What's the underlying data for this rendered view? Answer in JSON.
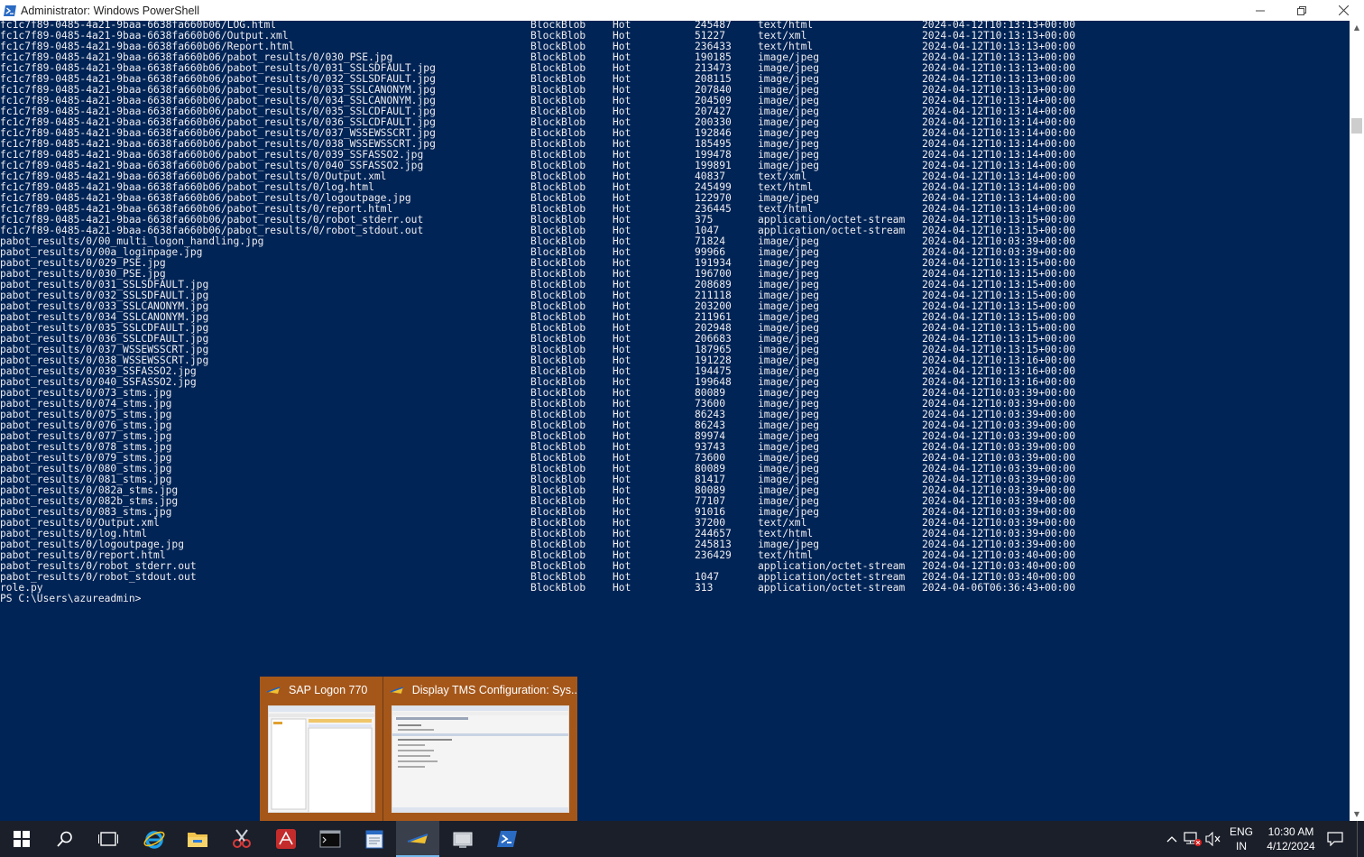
{
  "window": {
    "title": "Administrator: Windows PowerShell"
  },
  "console": {
    "rows": [
      {
        "name": "fc1c7f89-0485-4a21-9baa-6638fa660b06/LOG.html",
        "type": "BlockBlob",
        "tier": "Hot",
        "size": "245487",
        "content_type": "text/html",
        "date": "2024-04-12T10:13:13+00:00"
      },
      {
        "name": "fc1c7f89-0485-4a21-9baa-6638fa660b06/Output.xml",
        "type": "BlockBlob",
        "tier": "Hot",
        "size": "51227",
        "content_type": "text/xml",
        "date": "2024-04-12T10:13:13+00:00"
      },
      {
        "name": "fc1c7f89-0485-4a21-9baa-6638fa660b06/Report.html",
        "type": "BlockBlob",
        "tier": "Hot",
        "size": "236433",
        "content_type": "text/html",
        "date": "2024-04-12T10:13:13+00:00"
      },
      {
        "name": "fc1c7f89-0485-4a21-9baa-6638fa660b06/pabot_results/0/030_PSE.jpg",
        "type": "BlockBlob",
        "tier": "Hot",
        "size": "190185",
        "content_type": "image/jpeg",
        "date": "2024-04-12T10:13:13+00:00"
      },
      {
        "name": "fc1c7f89-0485-4a21-9baa-6638fa660b06/pabot_results/0/031_SSLSDFAULT.jpg",
        "type": "BlockBlob",
        "tier": "Hot",
        "size": "213473",
        "content_type": "image/jpeg",
        "date": "2024-04-12T10:13:13+00:00"
      },
      {
        "name": "fc1c7f89-0485-4a21-9baa-6638fa660b06/pabot_results/0/032_SSLSDFAULT.jpg",
        "type": "BlockBlob",
        "tier": "Hot",
        "size": "208115",
        "content_type": "image/jpeg",
        "date": "2024-04-12T10:13:13+00:00"
      },
      {
        "name": "fc1c7f89-0485-4a21-9baa-6638fa660b06/pabot_results/0/033_SSLCANONYM.jpg",
        "type": "BlockBlob",
        "tier": "Hot",
        "size": "207840",
        "content_type": "image/jpeg",
        "date": "2024-04-12T10:13:13+00:00"
      },
      {
        "name": "fc1c7f89-0485-4a21-9baa-6638fa660b06/pabot_results/0/034_SSLCANONYM.jpg",
        "type": "BlockBlob",
        "tier": "Hot",
        "size": "204509",
        "content_type": "image/jpeg",
        "date": "2024-04-12T10:13:14+00:00"
      },
      {
        "name": "fc1c7f89-0485-4a21-9baa-6638fa660b06/pabot_results/0/035_SSLCDFAULT.jpg",
        "type": "BlockBlob",
        "tier": "Hot",
        "size": "207427",
        "content_type": "image/jpeg",
        "date": "2024-04-12T10:13:14+00:00"
      },
      {
        "name": "fc1c7f89-0485-4a21-9baa-6638fa660b06/pabot_results/0/036_SSLCDFAULT.jpg",
        "type": "BlockBlob",
        "tier": "Hot",
        "size": "200330",
        "content_type": "image/jpeg",
        "date": "2024-04-12T10:13:14+00:00"
      },
      {
        "name": "fc1c7f89-0485-4a21-9baa-6638fa660b06/pabot_results/0/037_WSSEWSSCRT.jpg",
        "type": "BlockBlob",
        "tier": "Hot",
        "size": "192846",
        "content_type": "image/jpeg",
        "date": "2024-04-12T10:13:14+00:00"
      },
      {
        "name": "fc1c7f89-0485-4a21-9baa-6638fa660b06/pabot_results/0/038_WSSEWSSCRT.jpg",
        "type": "BlockBlob",
        "tier": "Hot",
        "size": "185495",
        "content_type": "image/jpeg",
        "date": "2024-04-12T10:13:14+00:00"
      },
      {
        "name": "fc1c7f89-0485-4a21-9baa-6638fa660b06/pabot_results/0/039_SSFASSO2.jpg",
        "type": "BlockBlob",
        "tier": "Hot",
        "size": "199478",
        "content_type": "image/jpeg",
        "date": "2024-04-12T10:13:14+00:00"
      },
      {
        "name": "fc1c7f89-0485-4a21-9baa-6638fa660b06/pabot_results/0/040_SSFASSO2.jpg",
        "type": "BlockBlob",
        "tier": "Hot",
        "size": "199891",
        "content_type": "image/jpeg",
        "date": "2024-04-12T10:13:14+00:00"
      },
      {
        "name": "fc1c7f89-0485-4a21-9baa-6638fa660b06/pabot_results/0/Output.xml",
        "type": "BlockBlob",
        "tier": "Hot",
        "size": "40837",
        "content_type": "text/xml",
        "date": "2024-04-12T10:13:14+00:00"
      },
      {
        "name": "fc1c7f89-0485-4a21-9baa-6638fa660b06/pabot_results/0/log.html",
        "type": "BlockBlob",
        "tier": "Hot",
        "size": "245499",
        "content_type": "text/html",
        "date": "2024-04-12T10:13:14+00:00"
      },
      {
        "name": "fc1c7f89-0485-4a21-9baa-6638fa660b06/pabot_results/0/logoutpage.jpg",
        "type": "BlockBlob",
        "tier": "Hot",
        "size": "122970",
        "content_type": "image/jpeg",
        "date": "2024-04-12T10:13:14+00:00"
      },
      {
        "name": "fc1c7f89-0485-4a21-9baa-6638fa660b06/pabot_results/0/report.html",
        "type": "BlockBlob",
        "tier": "Hot",
        "size": "236445",
        "content_type": "text/html",
        "date": "2024-04-12T10:13:14+00:00"
      },
      {
        "name": "fc1c7f89-0485-4a21-9baa-6638fa660b06/pabot_results/0/robot_stderr.out",
        "type": "BlockBlob",
        "tier": "Hot",
        "size": "375",
        "content_type": "application/octet-stream",
        "date": "2024-04-12T10:13:15+00:00"
      },
      {
        "name": "fc1c7f89-0485-4a21-9baa-6638fa660b06/pabot_results/0/robot_stdout.out",
        "type": "BlockBlob",
        "tier": "Hot",
        "size": "1047",
        "content_type": "application/octet-stream",
        "date": "2024-04-12T10:13:15+00:00"
      },
      {
        "name": "pabot_results/0/00_multi_logon_handling.jpg",
        "type": "BlockBlob",
        "tier": "Hot",
        "size": "71824",
        "content_type": "image/jpeg",
        "date": "2024-04-12T10:03:39+00:00"
      },
      {
        "name": "pabot_results/0/00a_loginpage.jpg",
        "type": "BlockBlob",
        "tier": "Hot",
        "size": "99966",
        "content_type": "image/jpeg",
        "date": "2024-04-12T10:03:39+00:00"
      },
      {
        "name": "pabot_results/0/029_PSE.jpg",
        "type": "BlockBlob",
        "tier": "Hot",
        "size": "191934",
        "content_type": "image/jpeg",
        "date": "2024-04-12T10:13:15+00:00"
      },
      {
        "name": "pabot_results/0/030_PSE.jpg",
        "type": "BlockBlob",
        "tier": "Hot",
        "size": "196700",
        "content_type": "image/jpeg",
        "date": "2024-04-12T10:13:15+00:00"
      },
      {
        "name": "pabot_results/0/031_SSLSDFAULT.jpg",
        "type": "BlockBlob",
        "tier": "Hot",
        "size": "208689",
        "content_type": "image/jpeg",
        "date": "2024-04-12T10:13:15+00:00"
      },
      {
        "name": "pabot_results/0/032_SSLSDFAULT.jpg",
        "type": "BlockBlob",
        "tier": "Hot",
        "size": "211118",
        "content_type": "image/jpeg",
        "date": "2024-04-12T10:13:15+00:00"
      },
      {
        "name": "pabot_results/0/033_SSLCANONYM.jpg",
        "type": "BlockBlob",
        "tier": "Hot",
        "size": "203200",
        "content_type": "image/jpeg",
        "date": "2024-04-12T10:13:15+00:00"
      },
      {
        "name": "pabot_results/0/034_SSLCANONYM.jpg",
        "type": "BlockBlob",
        "tier": "Hot",
        "size": "211961",
        "content_type": "image/jpeg",
        "date": "2024-04-12T10:13:15+00:00"
      },
      {
        "name": "pabot_results/0/035_SSLCDFAULT.jpg",
        "type": "BlockBlob",
        "tier": "Hot",
        "size": "202948",
        "content_type": "image/jpeg",
        "date": "2024-04-12T10:13:15+00:00"
      },
      {
        "name": "pabot_results/0/036_SSLCDFAULT.jpg",
        "type": "BlockBlob",
        "tier": "Hot",
        "size": "206683",
        "content_type": "image/jpeg",
        "date": "2024-04-12T10:13:15+00:00"
      },
      {
        "name": "pabot_results/0/037_WSSEWSSCRT.jpg",
        "type": "BlockBlob",
        "tier": "Hot",
        "size": "187965",
        "content_type": "image/jpeg",
        "date": "2024-04-12T10:13:15+00:00"
      },
      {
        "name": "pabot_results/0/038_WSSEWSSCRT.jpg",
        "type": "BlockBlob",
        "tier": "Hot",
        "size": "191228",
        "content_type": "image/jpeg",
        "date": "2024-04-12T10:13:16+00:00"
      },
      {
        "name": "pabot_results/0/039_SSFASSO2.jpg",
        "type": "BlockBlob",
        "tier": "Hot",
        "size": "194475",
        "content_type": "image/jpeg",
        "date": "2024-04-12T10:13:16+00:00"
      },
      {
        "name": "pabot_results/0/040_SSFASSO2.jpg",
        "type": "BlockBlob",
        "tier": "Hot",
        "size": "199648",
        "content_type": "image/jpeg",
        "date": "2024-04-12T10:13:16+00:00"
      },
      {
        "name": "pabot_results/0/073_stms.jpg",
        "type": "BlockBlob",
        "tier": "Hot",
        "size": "80089",
        "content_type": "image/jpeg",
        "date": "2024-04-12T10:03:39+00:00"
      },
      {
        "name": "pabot_results/0/074_stms.jpg",
        "type": "BlockBlob",
        "tier": "Hot",
        "size": "73600",
        "content_type": "image/jpeg",
        "date": "2024-04-12T10:03:39+00:00"
      },
      {
        "name": "pabot_results/0/075_stms.jpg",
        "type": "BlockBlob",
        "tier": "Hot",
        "size": "86243",
        "content_type": "image/jpeg",
        "date": "2024-04-12T10:03:39+00:00"
      },
      {
        "name": "pabot_results/0/076_stms.jpg",
        "type": "BlockBlob",
        "tier": "Hot",
        "size": "86243",
        "content_type": "image/jpeg",
        "date": "2024-04-12T10:03:39+00:00"
      },
      {
        "name": "pabot_results/0/077_stms.jpg",
        "type": "BlockBlob",
        "tier": "Hot",
        "size": "89974",
        "content_type": "image/jpeg",
        "date": "2024-04-12T10:03:39+00:00"
      },
      {
        "name": "pabot_results/0/078_stms.jpg",
        "type": "BlockBlob",
        "tier": "Hot",
        "size": "93743",
        "content_type": "image/jpeg",
        "date": "2024-04-12T10:03:39+00:00"
      },
      {
        "name": "pabot_results/0/079_stms.jpg",
        "type": "BlockBlob",
        "tier": "Hot",
        "size": "73600",
        "content_type": "image/jpeg",
        "date": "2024-04-12T10:03:39+00:00"
      },
      {
        "name": "pabot_results/0/080_stms.jpg",
        "type": "BlockBlob",
        "tier": "Hot",
        "size": "80089",
        "content_type": "image/jpeg",
        "date": "2024-04-12T10:03:39+00:00"
      },
      {
        "name": "pabot_results/0/081_stms.jpg",
        "type": "BlockBlob",
        "tier": "Hot",
        "size": "81417",
        "content_type": "image/jpeg",
        "date": "2024-04-12T10:03:39+00:00"
      },
      {
        "name": "pabot_results/0/082a_stms.jpg",
        "type": "BlockBlob",
        "tier": "Hot",
        "size": "80089",
        "content_type": "image/jpeg",
        "date": "2024-04-12T10:03:39+00:00"
      },
      {
        "name": "pabot_results/0/082b_stms.jpg",
        "type": "BlockBlob",
        "tier": "Hot",
        "size": "77107",
        "content_type": "image/jpeg",
        "date": "2024-04-12T10:03:39+00:00"
      },
      {
        "name": "pabot_results/0/083_stms.jpg",
        "type": "BlockBlob",
        "tier": "Hot",
        "size": "91016",
        "content_type": "image/jpeg",
        "date": "2024-04-12T10:03:39+00:00"
      },
      {
        "name": "pabot_results/0/Output.xml",
        "type": "BlockBlob",
        "tier": "Hot",
        "size": "37200",
        "content_type": "text/xml",
        "date": "2024-04-12T10:03:39+00:00"
      },
      {
        "name": "pabot_results/0/log.html",
        "type": "BlockBlob",
        "tier": "Hot",
        "size": "244657",
        "content_type": "text/html",
        "date": "2024-04-12T10:03:39+00:00"
      },
      {
        "name": "pabot_results/0/logoutpage.jpg",
        "type": "BlockBlob",
        "tier": "Hot",
        "size": "245813",
        "content_type": "image/jpeg",
        "date": "2024-04-12T10:03:39+00:00"
      },
      {
        "name": "pabot_results/0/report.html",
        "type": "BlockBlob",
        "tier": "Hot",
        "size": "236429",
        "content_type": "text/html",
        "date": "2024-04-12T10:03:40+00:00"
      },
      {
        "name": "pabot_results/0/robot_stderr.out",
        "type": "BlockBlob",
        "tier": "Hot",
        "size": "",
        "content_type": "application/octet-stream",
        "date": "2024-04-12T10:03:40+00:00"
      },
      {
        "name": "pabot_results/0/robot_stdout.out",
        "type": "BlockBlob",
        "tier": "Hot",
        "size": "1047",
        "content_type": "application/octet-stream",
        "date": "2024-04-12T10:03:40+00:00"
      },
      {
        "name": "role.py",
        "type": "BlockBlob",
        "tier": "Hot",
        "size": "313",
        "content_type": "application/octet-stream",
        "date": "2024-04-06T06:36:43+00:00"
      }
    ],
    "prompt": "PS C:\\Users\\azureadmin>"
  },
  "thumbnails": [
    {
      "label": "SAP Logon 770",
      "icon": "sap-logon-icon"
    },
    {
      "label": "Display TMS Configuration: Sys...",
      "icon": "sap-gui-icon"
    }
  ],
  "taskbar": {
    "apps": [
      {
        "name": "start-button",
        "icon": "windows-logo-icon"
      },
      {
        "name": "search-button",
        "icon": "search-icon"
      },
      {
        "name": "task-view-button",
        "icon": "task-view-icon"
      },
      {
        "name": "internet-explorer-button",
        "icon": "internet-explorer-icon"
      },
      {
        "name": "file-explorer-button",
        "icon": "folder-icon"
      },
      {
        "name": "snipping-tool-button",
        "icon": "scissors-icon"
      },
      {
        "name": "app-red-button",
        "icon": "app-icon"
      },
      {
        "name": "command-prompt-button",
        "icon": "terminal-icon"
      },
      {
        "name": "notepad-button",
        "icon": "notepad-icon"
      },
      {
        "name": "sap-logon-taskbar-button",
        "icon": "sap-logon-icon"
      },
      {
        "name": "server-manager-button",
        "icon": "server-manager-icon"
      },
      {
        "name": "powershell-taskbar-button",
        "icon": "powershell-icon"
      }
    ],
    "tray": {
      "lang_top": "ENG",
      "lang_bottom": "IN",
      "time": "10:30 AM",
      "date": "4/12/2024"
    }
  },
  "colors": {
    "console_bg": "#012456",
    "console_fg": "#eeedf0",
    "taskbar_bg": "#1b1f2a",
    "thumb_popup_bg": "#a5571a"
  }
}
